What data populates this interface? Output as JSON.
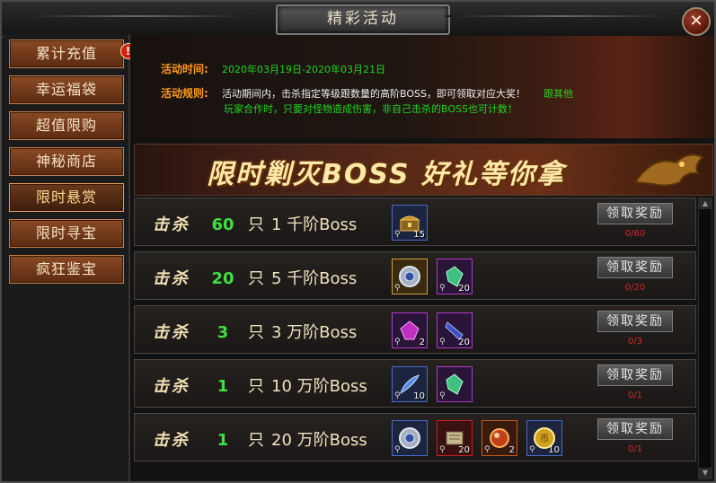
{
  "window": {
    "title": "精彩活动",
    "close_label": "✕"
  },
  "sidebar": {
    "items": [
      {
        "label": "累计充值",
        "active": false,
        "alert": "!"
      },
      {
        "label": "幸运福袋",
        "active": false
      },
      {
        "label": "超值限购",
        "active": false
      },
      {
        "label": "神秘商店",
        "active": false
      },
      {
        "label": "限时悬赏",
        "active": true
      },
      {
        "label": "限时寻宝",
        "active": false
      },
      {
        "label": "疯狂鉴宝",
        "active": false
      }
    ]
  },
  "info": {
    "time_label": "活动时间:",
    "time_value": "2020年03月19日-2020年03月21日",
    "rule_label": "活动规则:",
    "rule_text_1": "活动期间内，击杀指定等级跟数量的高阶BOSS，即可领取对应大奖！",
    "rule_text_1b": "跟其他",
    "rule_text_2": "玩家合作时，只要对怪物造成伤害，非自己击杀的BOSS也可计数！"
  },
  "banner": {
    "text": "限时剿灭BOSS  好礼等你拿"
  },
  "rows": [
    {
      "kill": "击杀",
      "count": "60",
      "unit": "只",
      "level": "1 千阶Boss",
      "claim": "领取奖励",
      "progress": "0/60",
      "items": [
        {
          "name": "treasure-chest-icon",
          "qty": "15",
          "tone": "blue"
        }
      ]
    },
    {
      "kill": "击杀",
      "count": "20",
      "unit": "只",
      "level": "5 千阶Boss",
      "claim": "领取奖励",
      "progress": "0/20",
      "items": [
        {
          "name": "silver-disc-icon",
          "qty": "",
          "tone": "gold"
        },
        {
          "name": "green-crystal-icon",
          "qty": "20",
          "tone": "purple"
        }
      ]
    },
    {
      "kill": "击杀",
      "count": "3",
      "unit": "只",
      "level": "3 万阶Boss",
      "claim": "领取奖励",
      "progress": "0/3",
      "items": [
        {
          "name": "purple-gem-icon",
          "qty": "2",
          "tone": "purple"
        },
        {
          "name": "blue-crystal-icon",
          "qty": "20",
          "tone": "purple"
        }
      ]
    },
    {
      "kill": "击杀",
      "count": "1",
      "unit": "只",
      "level": "10 万阶Boss",
      "claim": "领取奖励",
      "progress": "0/1",
      "items": [
        {
          "name": "blue-feather-icon",
          "qty": "10",
          "tone": "blue"
        },
        {
          "name": "green-crystal-icon",
          "qty": "",
          "tone": "purple"
        }
      ]
    },
    {
      "kill": "击杀",
      "count": "1",
      "unit": "只",
      "level": "20 万阶Boss",
      "claim": "领取奖励",
      "progress": "0/1",
      "items": [
        {
          "name": "silver-disc-icon",
          "qty": "",
          "tone": "blue"
        },
        {
          "name": "scroll-icon",
          "qty": "20",
          "tone": "red"
        },
        {
          "name": "red-orb-icon",
          "qty": "2",
          "tone": "orange"
        },
        {
          "name": "gold-coin-icon",
          "qty": "10",
          "tone": "blue"
        }
      ]
    }
  ],
  "colors": {
    "accent": "#ff9a1a",
    "green": "#23d423",
    "progress_red": "#d42a2a"
  }
}
